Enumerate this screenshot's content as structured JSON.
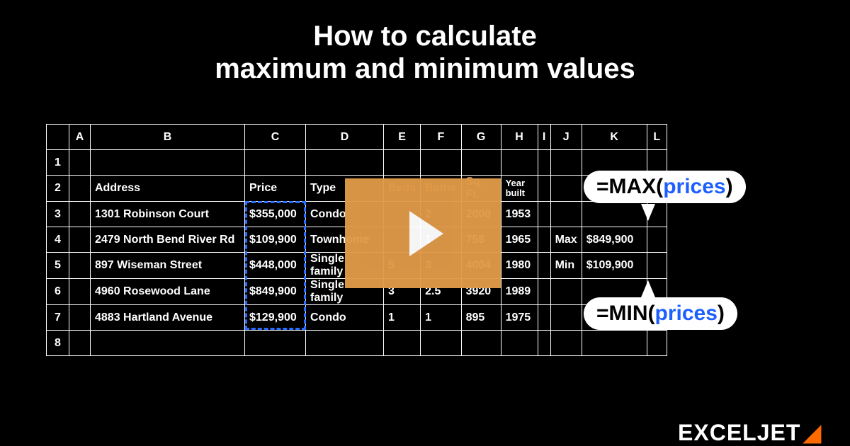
{
  "title_line1": "How to calculate",
  "title_line2": "maximum and minimum values",
  "cols": [
    "A",
    "B",
    "C",
    "D",
    "E",
    "F",
    "G",
    "H",
    "I",
    "J",
    "K",
    "L"
  ],
  "rowNums": [
    "1",
    "2",
    "3",
    "4",
    "5",
    "6",
    "7",
    "8"
  ],
  "headers": {
    "address": "Address",
    "price": "Price",
    "type": "Type",
    "beds": "Beds",
    "baths": "Baths",
    "sqft": "Sq. Ft.",
    "year": "Year built"
  },
  "rows": [
    {
      "addr": "1301 Robinson Court",
      "price": "$355,000",
      "type": "Condo",
      "beds": "",
      "baths": "2",
      "sqft": "2000",
      "year": "1953"
    },
    {
      "addr": "2479 North Bend River Rd",
      "price": "$109,900",
      "type": "Townhome",
      "beds": "",
      "baths": "1",
      "sqft": "758",
      "year": "1965"
    },
    {
      "addr": "897 Wiseman Street",
      "price": "$448,000",
      "type": "Single family",
      "beds": "5",
      "baths": "3",
      "sqft": "4004",
      "year": "1980"
    },
    {
      "addr": "4960 Rosewood Lane",
      "price": "$849,900",
      "type": "Single family",
      "beds": "3",
      "baths": "2.5",
      "sqft": "3920",
      "year": "1989"
    },
    {
      "addr": "4883 Hartland Avenue",
      "price": "$129,900",
      "type": "Condo",
      "beds": "1",
      "baths": "1",
      "sqft": "895",
      "year": "1975"
    }
  ],
  "summary": {
    "maxLabel": "Max",
    "maxValue": "$849,900",
    "minLabel": "Min",
    "minValue": "$109,900"
  },
  "formulas": {
    "max_pre": "=MAX(",
    "max_arg": "prices",
    "max_post": ")",
    "min_pre": "=MIN(",
    "min_arg": "prices",
    "min_post": ")"
  },
  "logo": {
    "text": "EXCELJET",
    "accent": "◢"
  }
}
